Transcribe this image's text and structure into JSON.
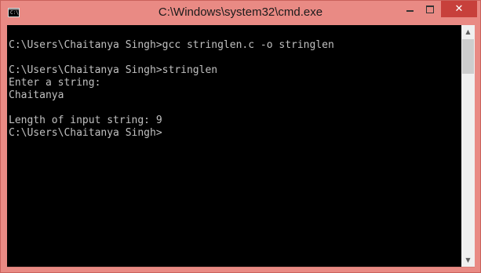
{
  "window": {
    "title": "C:\\Windows\\system32\\cmd.exe",
    "icon_label": "C:\\",
    "minimize_icon": "minimize-icon",
    "maximize_icon": "maximize-icon",
    "close_symbol": "✕",
    "frame_color": "#e98a84",
    "close_color": "#c7403b"
  },
  "console": {
    "background": "#000000",
    "text_color": "#c0c0c0",
    "lines": [
      "C:\\Users\\Chaitanya Singh>gcc stringlen.c -o stringlen",
      "",
      "C:\\Users\\Chaitanya Singh>stringlen",
      "Enter a string:",
      "Chaitanya",
      "",
      "Length of input string: 9",
      "C:\\Users\\Chaitanya Singh>"
    ]
  },
  "scrollbar": {
    "up_symbol": "▲",
    "down_symbol": "▼"
  }
}
